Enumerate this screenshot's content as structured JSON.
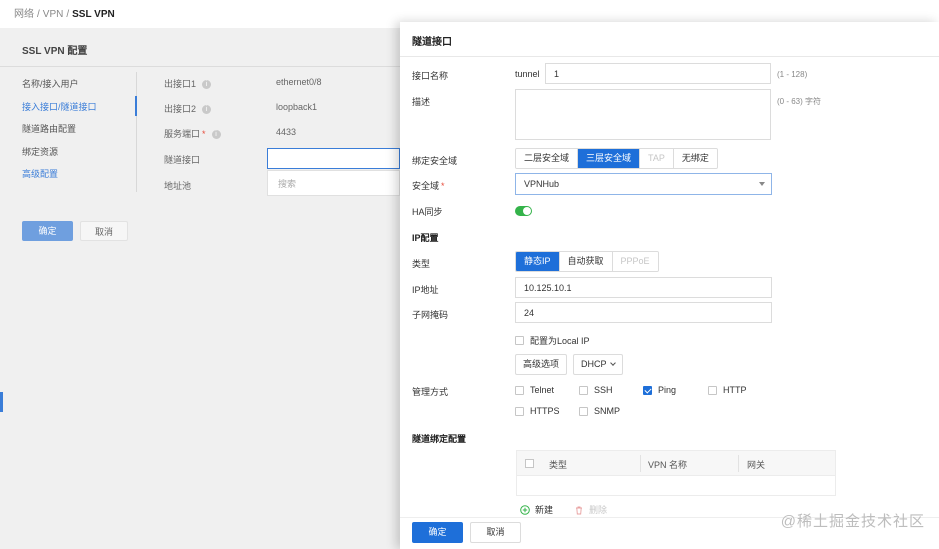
{
  "breadcrumb": {
    "item1": "网络",
    "item2": "VPN",
    "current": "SSL VPN",
    "sep": "/"
  },
  "back": {
    "title": "SSL VPN 配置",
    "nav": [
      "名称/接入用户",
      "接入接口/隧道接口",
      "隧道路由配置",
      "绑定资源",
      "高级配置"
    ],
    "fields": [
      {
        "label": "出接口1",
        "value": "ethernet0/8"
      },
      {
        "label": "出接口2",
        "value": "loopback1"
      },
      {
        "label": "服务端口",
        "value": "4433"
      },
      {
        "label": "隧道接口",
        "value": ""
      },
      {
        "label": "地址池",
        "value": ""
      }
    ],
    "search_placeholder": "搜索",
    "ok": "确定",
    "cancel": "取消",
    "info_glyph": "i",
    "req": "*"
  },
  "drawer": {
    "title": "隧道接口",
    "if_name_label": "接口名称",
    "if_prefix": "tunnel",
    "if_value": "1",
    "if_hint": "(1 - 128)",
    "desc_label": "描述",
    "desc_hint": "(0 - 63) 字符",
    "bind_zone_label": "绑定安全域",
    "bind_zone_options": [
      "二层安全域",
      "三层安全域",
      "TAP",
      "无绑定"
    ],
    "zone_label": "安全域",
    "zone_value": "VPNHub",
    "ha_label": "HA同步",
    "ip_section": "IP配置",
    "type_label": "类型",
    "type_options": [
      "静态IP",
      "自动获取",
      "PPPoE"
    ],
    "ip_label": "IP地址",
    "ip_value": "10.125.10.1",
    "mask_label": "子网掩码",
    "mask_value": "24",
    "local_ip_label": "配置为Local IP",
    "adv_button": "高级选项",
    "dhcp_button": "DHCP",
    "mgmt_label": "管理方式",
    "mgmt": {
      "telnet": "Telnet",
      "ssh": "SSH",
      "ping": "Ping",
      "http": "HTTP",
      "https": "HTTPS",
      "snmp": "SNMP"
    },
    "tunnel_section": "隧道绑定配置",
    "table_cols": [
      "类型",
      "VPN 名称",
      "网关"
    ],
    "add_label": "新建",
    "delete_label": "删除",
    "ok": "确定",
    "cancel": "取消"
  },
  "watermark": "@稀土掘金技术社区",
  "colors": {
    "primary": "#1e6fd9",
    "toggle_on": "#34b34a",
    "required": "#e74c3c"
  }
}
